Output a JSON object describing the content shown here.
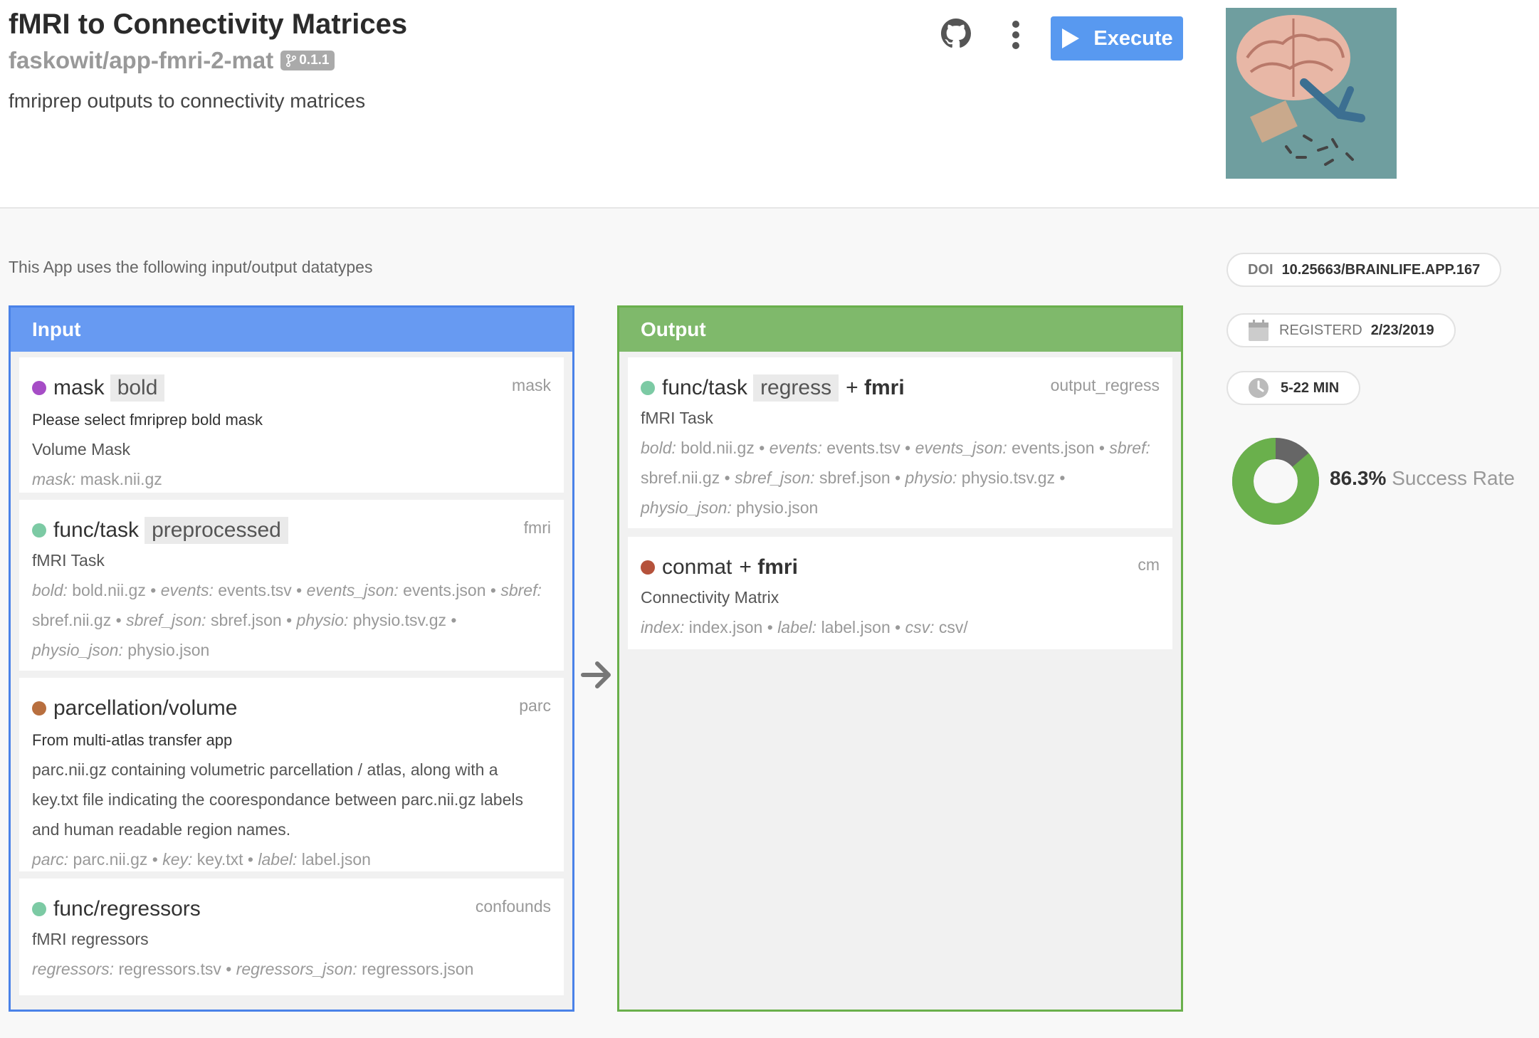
{
  "app": {
    "title": "fMRI to Connectivity Matrices",
    "repo": "faskowit/app-fmri-2-mat",
    "version": "0.1.1",
    "description": "fmriprep outputs to connectivity matrices",
    "execute_label": "Execute"
  },
  "lead_text": "This App uses the following input/output datatypes",
  "input": {
    "header": "Input",
    "items": [
      {
        "dot_color": "#a64dc6",
        "name": "mask",
        "chip": "bold",
        "tag": "mask",
        "note": "Please select fmriprep bold mask",
        "desc": "Volume Mask",
        "files": [
          {
            "k": "mask:",
            "v": "mask.nii.gz"
          }
        ]
      },
      {
        "dot_color": "#7ccaa4",
        "name": "func/task",
        "chip": "preprocessed",
        "tag": "fmri",
        "desc": "fMRI Task",
        "files_l1": [
          {
            "k": "bold:",
            "v": "bold.nii.gz"
          },
          {
            "k": "events:",
            "v": "events.tsv"
          },
          {
            "k": "events_json:",
            "v": "events.json"
          },
          {
            "k": "sbref:",
            "v": ""
          }
        ],
        "files_l2": [
          {
            "k": "",
            "v": "sbref.nii.gz"
          },
          {
            "k": "sbref_json:",
            "v": "sbref.json"
          },
          {
            "k": "physio:",
            "v": "physio.tsv.gz"
          }
        ],
        "files_l3": [
          {
            "k": "physio_json:",
            "v": "physio.json"
          }
        ]
      },
      {
        "dot_color": "#b86f3f",
        "name": "parcellation/volume",
        "tag": "parc",
        "note": "From multi-atlas transfer app",
        "desc_lines": [
          "parc.nii.gz containing volumetric parcellation / atlas, along with a",
          "key.txt file indicating the coorespondance between parc.nii.gz labels",
          "and human readable region names."
        ],
        "files": [
          {
            "k": "parc:",
            "v": "parc.nii.gz"
          },
          {
            "k": "key:",
            "v": "key.txt"
          },
          {
            "k": "label:",
            "v": "label.json"
          }
        ]
      },
      {
        "dot_color": "#7ccaa4",
        "name": "func/regressors",
        "tag": "confounds",
        "desc": "fMRI regressors",
        "files": [
          {
            "k": "regressors:",
            "v": "regressors.tsv"
          },
          {
            "k": "regressors_json:",
            "v": "regressors.json"
          }
        ]
      }
    ]
  },
  "output": {
    "header": "Output",
    "items": [
      {
        "dot_color": "#7ccaa4",
        "name": "func/task",
        "chip": "regress",
        "plus": "+",
        "plus_tag": "fmri",
        "tag": "output_regress",
        "desc": "fMRI Task",
        "files_l1": [
          {
            "k": "bold:",
            "v": "bold.nii.gz"
          },
          {
            "k": "events:",
            "v": "events.tsv"
          },
          {
            "k": "events_json:",
            "v": "events.json"
          },
          {
            "k": "sbref:",
            "v": ""
          }
        ],
        "files_l2": [
          {
            "k": "",
            "v": "sbref.nii.gz"
          },
          {
            "k": "sbref_json:",
            "v": "sbref.json"
          },
          {
            "k": "physio:",
            "v": "physio.tsv.gz"
          }
        ],
        "files_l3": [
          {
            "k": "physio_json:",
            "v": "physio.json"
          }
        ]
      },
      {
        "dot_color": "#b5523b",
        "name": "conmat",
        "plus": "+",
        "plus_tag": "fmri",
        "tag": "cm",
        "desc": "Connectivity Matrix",
        "files": [
          {
            "k": "index:",
            "v": "index.json"
          },
          {
            "k": "label:",
            "v": "label.json"
          },
          {
            "k": "csv:",
            "v": "csv/"
          }
        ]
      }
    ]
  },
  "meta": {
    "doi_label": "DOI",
    "doi": "10.25663/BRAINLIFE.APP.167",
    "registered_label": "REGISTERD",
    "registered": "2/23/2019",
    "duration": "5-22 MIN",
    "success_rate_value": "86.3%",
    "success_rate_label": "Success Rate",
    "success_fraction": 0.863
  },
  "colors": {
    "input_border": "#4a82e8",
    "output_border": "#6ab04c",
    "execute": "#5899f0",
    "donut_success": "#6ab04c",
    "donut_fail": "#666666"
  }
}
